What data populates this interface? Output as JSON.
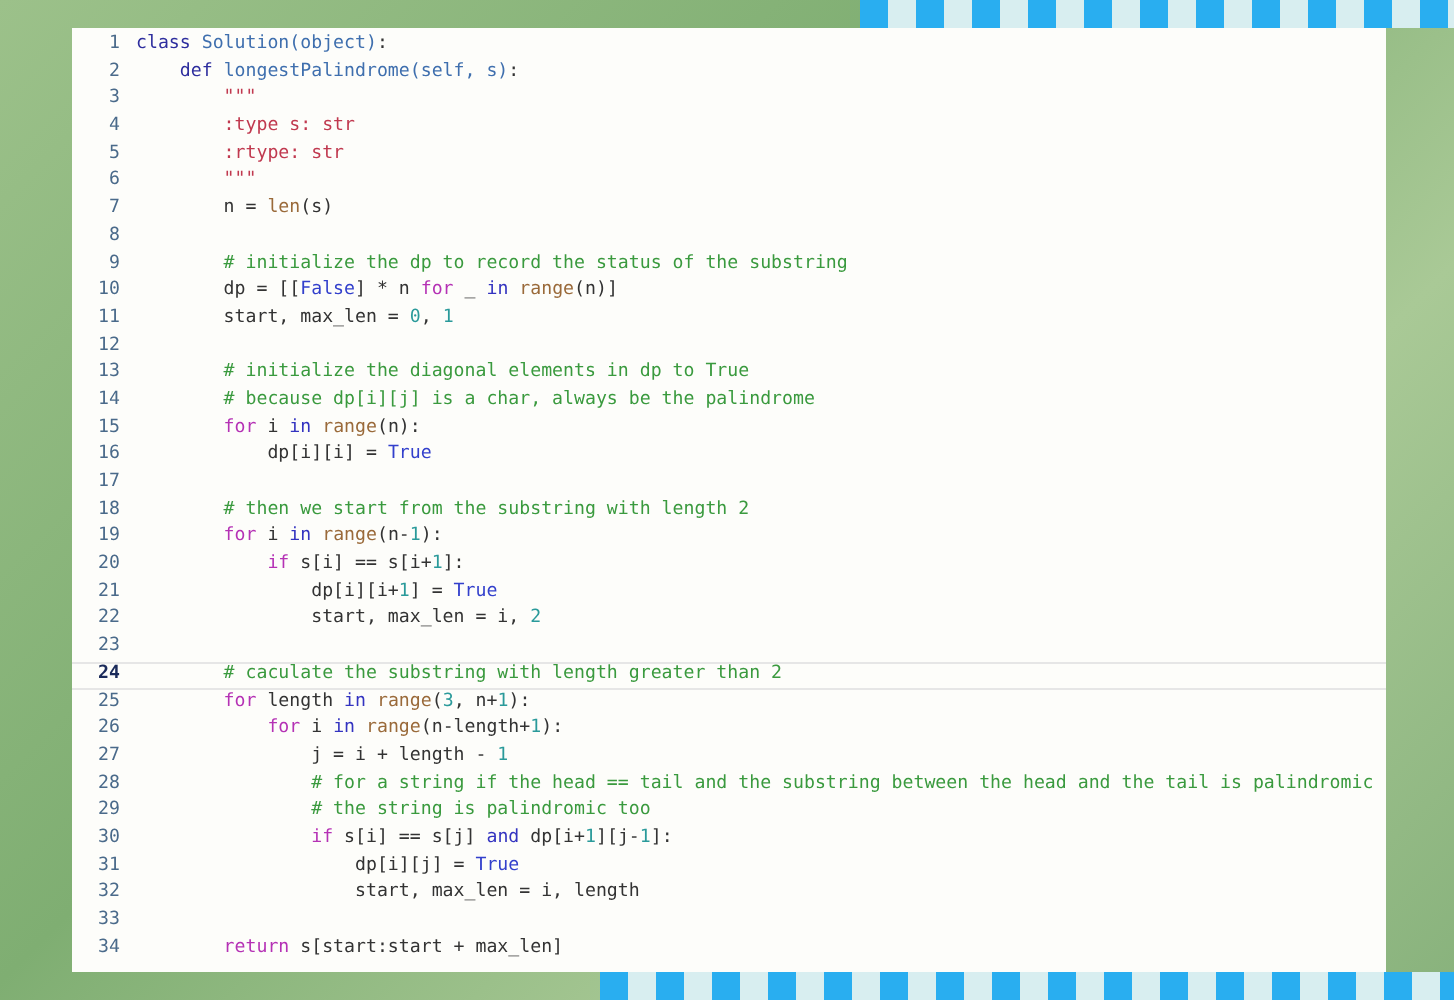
{
  "editor": {
    "lines": [
      {
        "number": "1",
        "current": false,
        "tokens": [
          {
            "kind": "keyword",
            "text": "class "
          },
          {
            "kind": "name",
            "text": "Solution(object)"
          },
          {
            "kind": "plain",
            "text": ":"
          }
        ]
      },
      {
        "number": "2",
        "current": false,
        "tokens": [
          {
            "kind": "keyword",
            "text": "    def "
          },
          {
            "kind": "name",
            "text": "longestPalindrome(self, s)"
          },
          {
            "kind": "plain",
            "text": ":"
          }
        ]
      },
      {
        "number": "3",
        "current": false,
        "tokens": [
          {
            "kind": "string",
            "text": "        \"\"\""
          }
        ]
      },
      {
        "number": "4",
        "current": false,
        "tokens": [
          {
            "kind": "string",
            "text": "        :type s: str"
          }
        ]
      },
      {
        "number": "5",
        "current": false,
        "tokens": [
          {
            "kind": "string",
            "text": "        :rtype: str"
          }
        ]
      },
      {
        "number": "6",
        "current": false,
        "tokens": [
          {
            "kind": "string",
            "text": "        \"\"\""
          }
        ]
      },
      {
        "number": "7",
        "current": false,
        "tokens": [
          {
            "kind": "plain",
            "text": "        n = "
          },
          {
            "kind": "builtin",
            "text": "len"
          },
          {
            "kind": "plain",
            "text": "(s)"
          }
        ]
      },
      {
        "number": "8",
        "current": false
      },
      {
        "number": "9",
        "current": false,
        "tokens": [
          {
            "kind": "comment",
            "text": "        # initialize the dp to record the status of the substring"
          }
        ]
      },
      {
        "number": "10",
        "current": false,
        "tokens": [
          {
            "kind": "plain",
            "text": "        dp = [["
          },
          {
            "kind": "constant",
            "text": "False"
          },
          {
            "kind": "plain",
            "text": "] * n "
          },
          {
            "kind": "control",
            "text": "for"
          },
          {
            "kind": "plain",
            "text": " _ "
          },
          {
            "kind": "operator",
            "text": "in"
          },
          {
            "kind": "builtin",
            "text": " range"
          },
          {
            "kind": "plain",
            "text": "(n)]"
          }
        ]
      },
      {
        "number": "11",
        "current": false,
        "tokens": [
          {
            "kind": "plain",
            "text": "        start, max_len = "
          },
          {
            "kind": "number",
            "text": "0"
          },
          {
            "kind": "plain",
            "text": ", "
          },
          {
            "kind": "number",
            "text": "1"
          }
        ]
      },
      {
        "number": "12",
        "current": false
      },
      {
        "number": "13",
        "current": false,
        "tokens": [
          {
            "kind": "comment",
            "text": "        # initialize the diagonal elements in dp to True"
          }
        ]
      },
      {
        "number": "14",
        "current": false,
        "tokens": [
          {
            "kind": "comment",
            "text": "        # because dp[i][j] is a char, always be the palindrome"
          }
        ]
      },
      {
        "number": "15",
        "current": false,
        "tokens": [
          {
            "kind": "control",
            "text": "        for"
          },
          {
            "kind": "plain",
            "text": " i "
          },
          {
            "kind": "operator",
            "text": "in"
          },
          {
            "kind": "builtin",
            "text": " range"
          },
          {
            "kind": "plain",
            "text": "(n):"
          }
        ]
      },
      {
        "number": "16",
        "current": false,
        "tokens": [
          {
            "kind": "plain",
            "text": "            dp[i][i] = "
          },
          {
            "kind": "constant",
            "text": "True"
          }
        ]
      },
      {
        "number": "17",
        "current": false
      },
      {
        "number": "18",
        "current": false,
        "tokens": [
          {
            "kind": "comment",
            "text": "        # then we start from the substring with length 2"
          }
        ]
      },
      {
        "number": "19",
        "current": false,
        "tokens": [
          {
            "kind": "control",
            "text": "        for"
          },
          {
            "kind": "plain",
            "text": " i "
          },
          {
            "kind": "operator",
            "text": "in"
          },
          {
            "kind": "builtin",
            "text": " range"
          },
          {
            "kind": "plain",
            "text": "(n-"
          },
          {
            "kind": "number",
            "text": "1"
          },
          {
            "kind": "plain",
            "text": "):"
          }
        ]
      },
      {
        "number": "20",
        "current": false,
        "tokens": [
          {
            "kind": "control",
            "text": "            if"
          },
          {
            "kind": "plain",
            "text": " s[i] == s[i+"
          },
          {
            "kind": "number",
            "text": "1"
          },
          {
            "kind": "plain",
            "text": "]:"
          }
        ]
      },
      {
        "number": "21",
        "current": false,
        "tokens": [
          {
            "kind": "plain",
            "text": "                dp[i][i+"
          },
          {
            "kind": "number",
            "text": "1"
          },
          {
            "kind": "plain",
            "text": "] = "
          },
          {
            "kind": "constant",
            "text": "True"
          }
        ]
      },
      {
        "number": "22",
        "current": false,
        "tokens": [
          {
            "kind": "plain",
            "text": "                start, max_len = i, "
          },
          {
            "kind": "number",
            "text": "2"
          }
        ]
      },
      {
        "number": "23",
        "current": false
      },
      {
        "number": "24",
        "current": true,
        "tokens": [
          {
            "kind": "comment",
            "text": "        # caculate the substring with length greater than 2"
          }
        ]
      },
      {
        "number": "25",
        "current": false,
        "tokens": [
          {
            "kind": "control",
            "text": "        for"
          },
          {
            "kind": "plain",
            "text": " length "
          },
          {
            "kind": "operator",
            "text": "in"
          },
          {
            "kind": "builtin",
            "text": " range"
          },
          {
            "kind": "plain",
            "text": "("
          },
          {
            "kind": "number",
            "text": "3"
          },
          {
            "kind": "plain",
            "text": ", n+"
          },
          {
            "kind": "number",
            "text": "1"
          },
          {
            "kind": "plain",
            "text": "):"
          }
        ]
      },
      {
        "number": "26",
        "current": false,
        "tokens": [
          {
            "kind": "control",
            "text": "            for"
          },
          {
            "kind": "plain",
            "text": " i "
          },
          {
            "kind": "operator",
            "text": "in"
          },
          {
            "kind": "builtin",
            "text": " range"
          },
          {
            "kind": "plain",
            "text": "(n-length+"
          },
          {
            "kind": "number",
            "text": "1"
          },
          {
            "kind": "plain",
            "text": "):"
          }
        ]
      },
      {
        "number": "27",
        "current": false,
        "tokens": [
          {
            "kind": "plain",
            "text": "                j = i + length - "
          },
          {
            "kind": "number",
            "text": "1"
          }
        ]
      },
      {
        "number": "28",
        "current": false,
        "tokens": [
          {
            "kind": "comment",
            "text": "                # for a string if the head == tail and the substring between the head and the tail is palindromic"
          }
        ]
      },
      {
        "number": "29",
        "current": false,
        "tokens": [
          {
            "kind": "comment",
            "text": "                # the string is palindromic too"
          }
        ]
      },
      {
        "number": "30",
        "current": false,
        "tokens": [
          {
            "kind": "control",
            "text": "                if"
          },
          {
            "kind": "plain",
            "text": " s[i] == s[j] "
          },
          {
            "kind": "operator",
            "text": "and"
          },
          {
            "kind": "plain",
            "text": " dp[i+"
          },
          {
            "kind": "number",
            "text": "1"
          },
          {
            "kind": "plain",
            "text": "][j-"
          },
          {
            "kind": "number",
            "text": "1"
          },
          {
            "kind": "plain",
            "text": "]:"
          }
        ]
      },
      {
        "number": "31",
        "current": false,
        "tokens": [
          {
            "kind": "plain",
            "text": "                    dp[i][j] = "
          },
          {
            "kind": "constant",
            "text": "True"
          }
        ]
      },
      {
        "number": "32",
        "current": false,
        "tokens": [
          {
            "kind": "plain",
            "text": "                    start, max_len = i, length"
          }
        ]
      },
      {
        "number": "33",
        "current": false
      },
      {
        "number": "34",
        "current": false,
        "tokens": [
          {
            "kind": "control",
            "text": "        return"
          },
          {
            "kind": "plain",
            "text": " s[start:start + max_len]"
          }
        ]
      }
    ]
  }
}
